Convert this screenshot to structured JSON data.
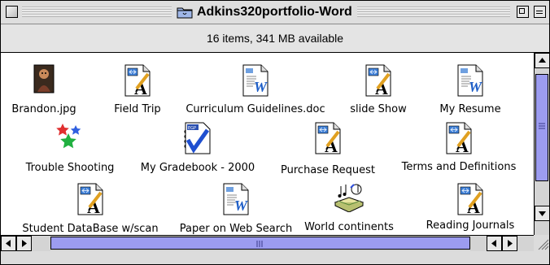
{
  "window": {
    "title": "Adkins320portfolio-Word",
    "status": "16 items, 341 MB available"
  },
  "files": [
    {
      "label": "Brandon.jpg",
      "icon": "photo-icon"
    },
    {
      "label": "Field Trip",
      "icon": "word-document-icon"
    },
    {
      "label": "Curriculum Guidelines.doc",
      "icon": "word-w-document-icon"
    },
    {
      "label": "slide Show",
      "icon": "word-document-icon"
    },
    {
      "label": "My Resume",
      "icon": "word-w-document-icon"
    },
    {
      "label": "Trouble Shooting",
      "icon": "stars-icon"
    },
    {
      "label": "My Gradebook - 2000",
      "icon": "gradebook-icon"
    },
    {
      "label": "Purchase Request",
      "icon": "word-document-icon"
    },
    {
      "label": "Terms and Definitions",
      "icon": "word-document-icon"
    },
    {
      "label": "Student DataBase w/scan",
      "icon": "word-document-icon"
    },
    {
      "label": "Paper on Web Search",
      "icon": "word-w-document-icon"
    },
    {
      "label": "World continents",
      "icon": "sound-book-icon"
    },
    {
      "label": "Reading Journals",
      "icon": "word-document-icon"
    }
  ],
  "colors": {
    "scroll_thumb": "#9c9cf0",
    "window_chrome": "#dedede"
  }
}
